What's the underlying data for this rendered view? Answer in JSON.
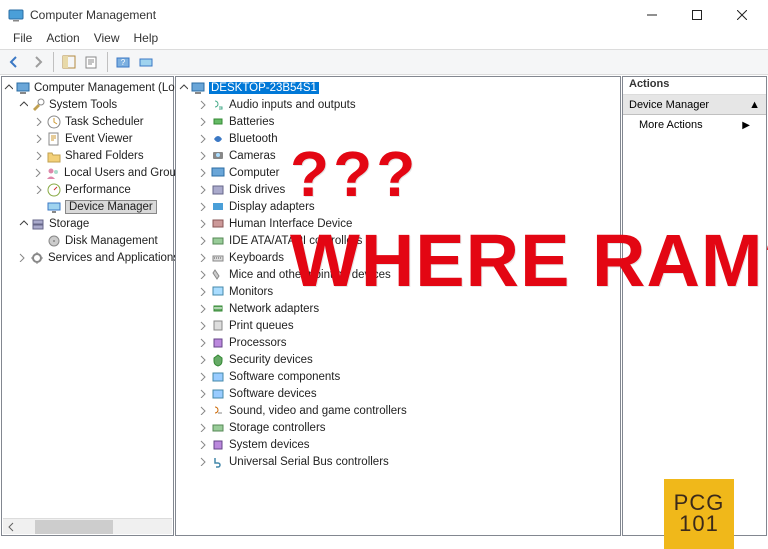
{
  "title": "Computer Management",
  "menu": {
    "file": "File",
    "action": "Action",
    "view": "View",
    "help": "Help"
  },
  "left_tree": [
    {
      "label": "Computer Management (Local",
      "indent": 1,
      "icon": "computer-mgmt",
      "expanded": true
    },
    {
      "label": "System Tools",
      "indent": 2,
      "icon": "tools",
      "expanded": true
    },
    {
      "label": "Task Scheduler",
      "indent": 3,
      "icon": "schedule",
      "expanded": false,
      "chev": true
    },
    {
      "label": "Event Viewer",
      "indent": 3,
      "icon": "event",
      "expanded": false,
      "chev": true
    },
    {
      "label": "Shared Folders",
      "indent": 3,
      "icon": "folder",
      "expanded": false,
      "chev": true
    },
    {
      "label": "Local Users and Groups",
      "indent": 3,
      "icon": "users",
      "expanded": false,
      "chev": true
    },
    {
      "label": "Performance",
      "indent": 3,
      "icon": "perf",
      "expanded": false,
      "chev": true
    },
    {
      "label": "Device Manager",
      "indent": 3,
      "icon": "device",
      "hl": true
    },
    {
      "label": "Storage",
      "indent": 2,
      "icon": "storage",
      "expanded": true
    },
    {
      "label": "Disk Management",
      "indent": 3,
      "icon": "disk"
    },
    {
      "label": "Services and Applications",
      "indent": 2,
      "icon": "services",
      "expanded": false,
      "chev": true
    }
  ],
  "mid_root": "DESKTOP-23B54S1",
  "mid_tree": [
    "Audio inputs and outputs",
    "Batteries",
    "Bluetooth",
    "Cameras",
    "Computer",
    "Disk drives",
    "Display adapters",
    "Human Interface Device",
    "IDE ATA/ATAPI controllers",
    "Keyboards",
    "Mice and other pointing devices",
    "Monitors",
    "Network adapters",
    "Print queues",
    "Processors",
    "Security devices",
    "Software components",
    "Software devices",
    "Sound, video and game controllers",
    "Storage controllers",
    "System devices",
    "Universal Serial Bus controllers"
  ],
  "actions": {
    "header": "Actions",
    "selected": "Device Manager",
    "more": "More Actions"
  },
  "overlay": {
    "q": "???",
    "text": "WHERE RAM?"
  },
  "logo1": "PCG",
  "logo2": "101"
}
